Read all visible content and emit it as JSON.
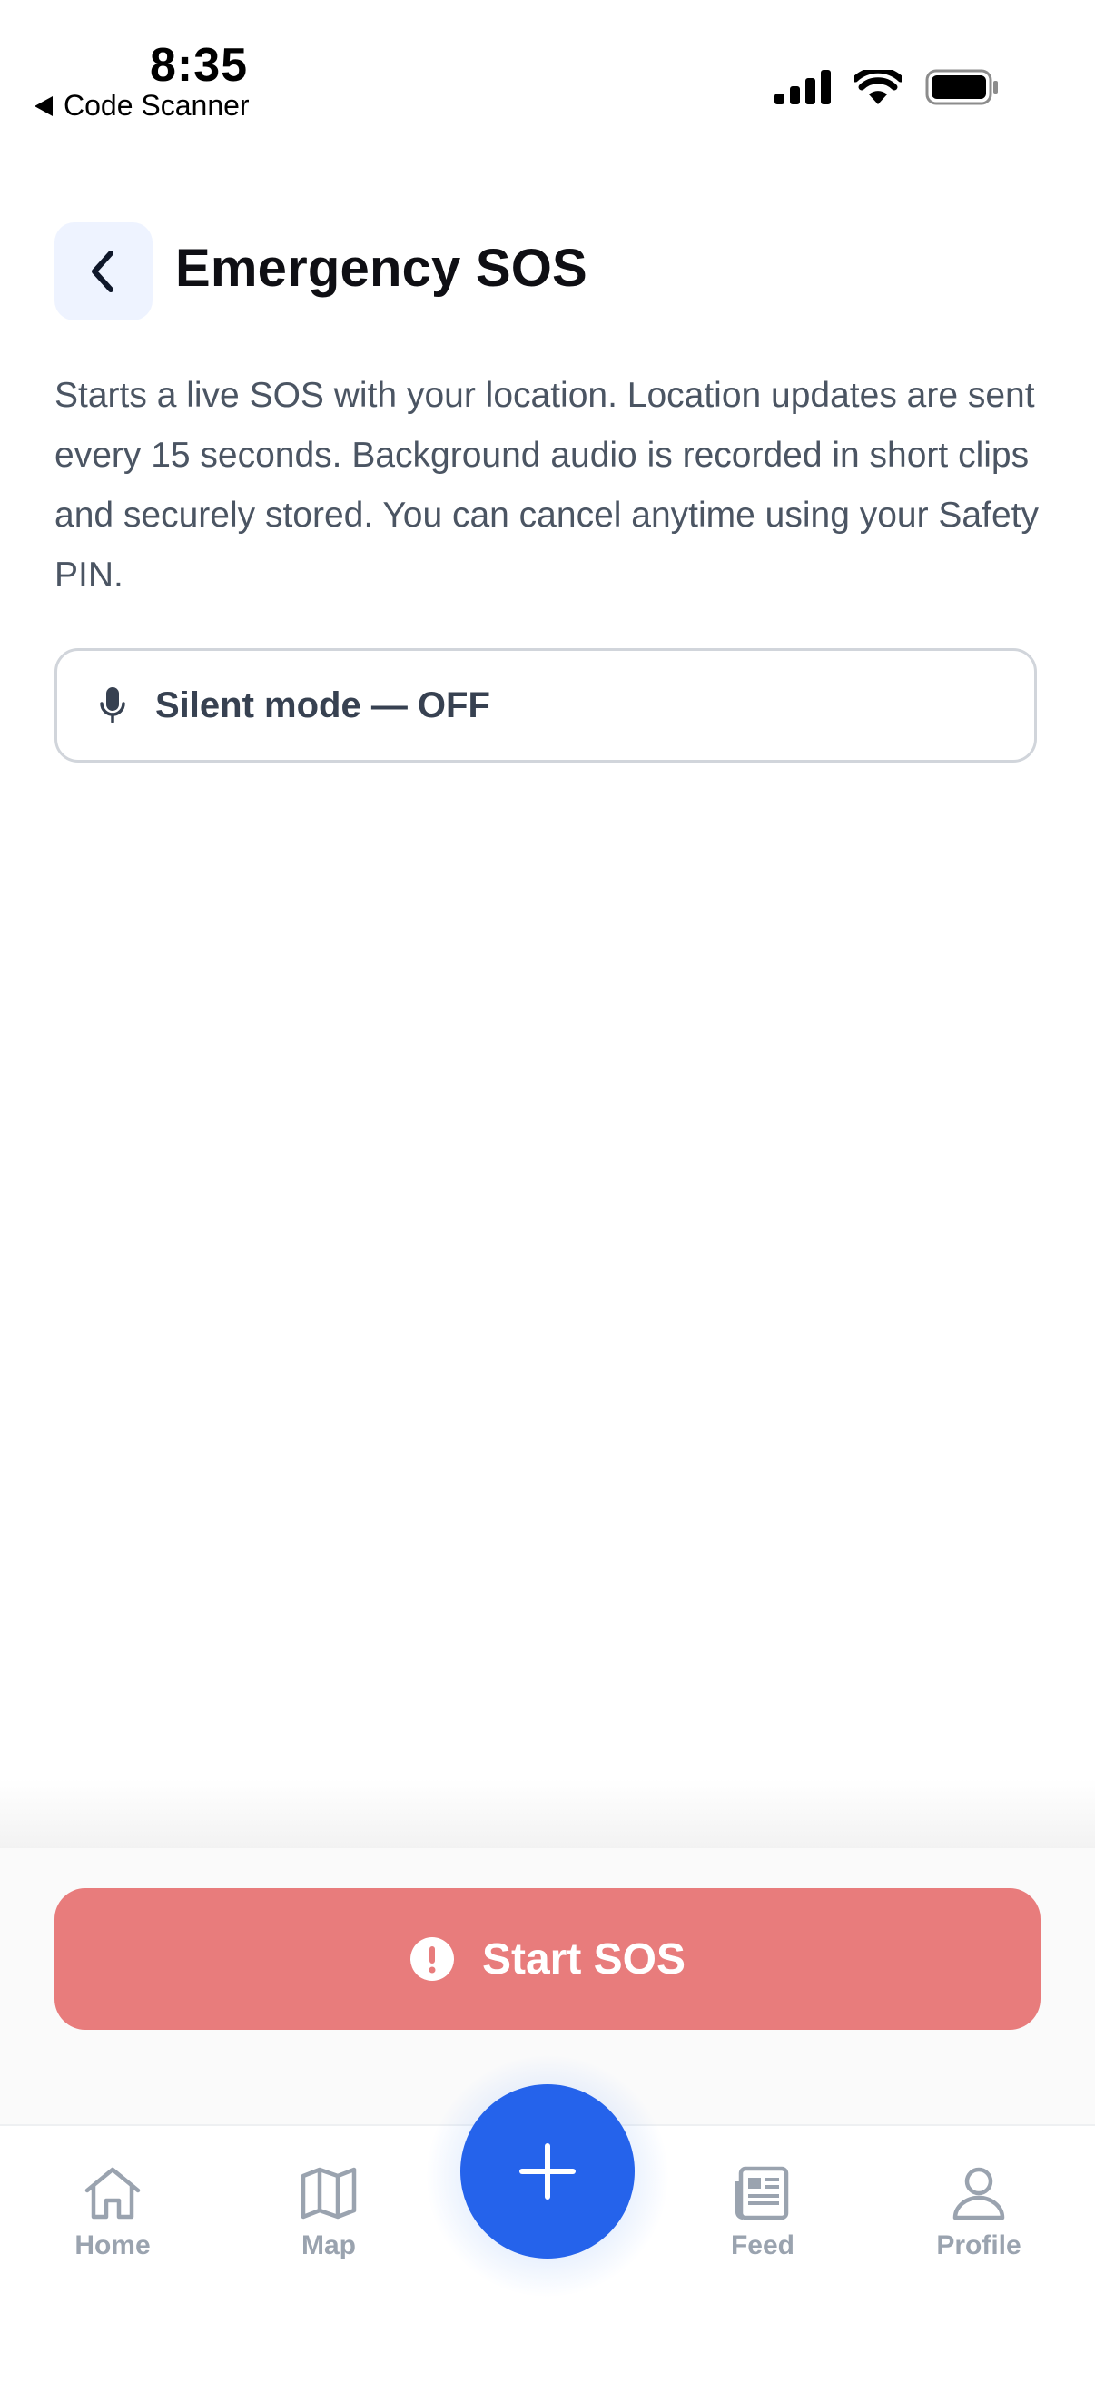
{
  "status_bar": {
    "time": "8:35",
    "back_app": "Code Scanner",
    "icons": [
      "cellular-signal-icon",
      "wifi-icon",
      "battery-icon"
    ]
  },
  "header": {
    "back_icon": "chevron-left-icon",
    "title": "Emergency SOS"
  },
  "description": "Starts a live SOS with your location. Location updates are sent every 15 seconds. Background audio is recorded in short clips and securely stored. You can cancel anytime using your Safety PIN.",
  "silent_mode": {
    "icon": "microphone-icon",
    "label": "Silent mode — OFF"
  },
  "sos_button": {
    "icon": "exclamation-circle-icon",
    "label": "Start SOS",
    "color": "#e87c7c"
  },
  "tabbar": {
    "tabs": [
      {
        "label": "Home",
        "icon": "home-icon"
      },
      {
        "label": "Map",
        "icon": "map-icon"
      },
      {
        "label": "Feed",
        "icon": "newspaper-icon"
      },
      {
        "label": "Profile",
        "icon": "user-icon"
      }
    ],
    "fab_icon": "plus-icon",
    "fab_color": "#2563eb"
  },
  "colors": {
    "accent": "#2563eb",
    "danger": "#e87c7c",
    "text_muted": "#4b5563",
    "tab_inactive": "#9aa3af"
  }
}
